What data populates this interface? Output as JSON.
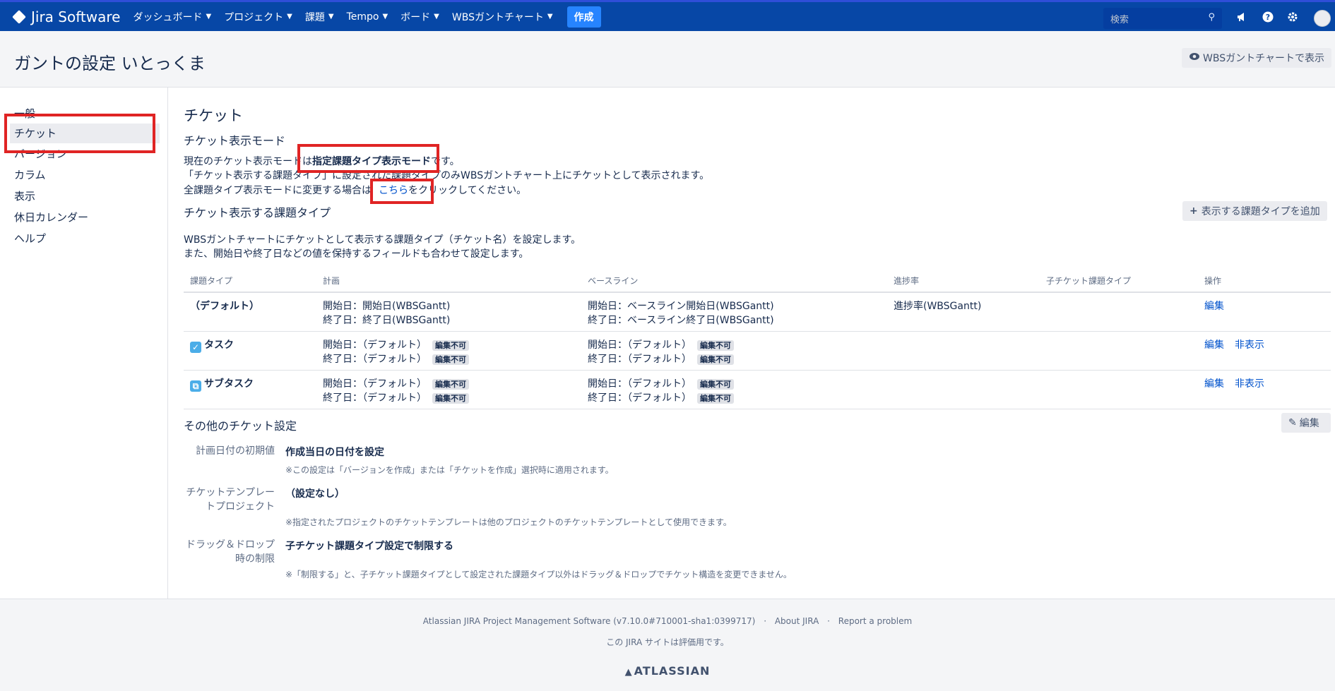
{
  "topnav": {
    "logo": "Jira Software",
    "items": [
      "ダッシュボード",
      "プロジェクト",
      "課題",
      "Tempo",
      "ボード",
      "WBSガントチャート"
    ],
    "create": "作成",
    "search_placeholder": "検索"
  },
  "header": {
    "title": "ガントの設定 いとっくま",
    "view_button": "WBSガントチャートで表示"
  },
  "sidebar": {
    "items": [
      "一般",
      "チケット",
      "バージョン",
      "カラム",
      "表示",
      "休日カレンダー",
      "ヘルプ"
    ]
  },
  "main": {
    "title": "チケット",
    "mode_heading": "チケット表示モード",
    "mode_line1_prefix": "現在のチケット表示モードは",
    "mode_line1_bold": "指定課題タイプ表示モード",
    "mode_line1_suffix": "です。",
    "mode_line2": "「チケット表示する課題タイプ」に設定された課題タイプのみWBSガントチャート上にチケットとして表示されます。",
    "mode_line3_prefix": "全課題タイプ表示モードに変更する場合は",
    "mode_line3_link": "こちら",
    "mode_line3_suffix": "をクリックしてください。",
    "types_heading": "チケット表示する課題タイプ",
    "add_type_button": "表示する課題タイプを追加",
    "types_desc1": "WBSガントチャートにチケットとして表示する課題タイプ（チケット名）を設定します。",
    "types_desc2": "また、開始日や終了日などの値を保持するフィールドも合わせて設定します。",
    "table": {
      "headers": [
        "課題タイプ",
        "計画",
        "ベースライン",
        "進捗率",
        "子チケット課題タイプ",
        "操作"
      ],
      "rows": [
        {
          "type": "（デフォルト）",
          "plan1": "開始日：開始日(WBSGantt)",
          "plan2": "終了日：終了日(WBSGantt)",
          "base1": "開始日：ベースライン開始日(WBSGantt)",
          "base2": "終了日：ベースライン終了日(WBSGantt)",
          "progress": "進捗率(WBSGantt)",
          "edit": "編集"
        },
        {
          "type": "タスク",
          "plan1": "開始日：（デフォルト）",
          "plan2": "終了日：（デフォルト）",
          "base1": "開始日：（デフォルト）",
          "base2": "終了日：（デフォルト）",
          "badge": "編集不可",
          "edit": "編集",
          "hide": "非表示"
        },
        {
          "type": "サブタスク",
          "plan1": "開始日：（デフォルト）",
          "plan2": "終了日：（デフォルト）",
          "base1": "開始日：（デフォルト）",
          "base2": "終了日：（デフォルト）",
          "badge": "編集不可",
          "edit": "編集",
          "hide": "非表示"
        }
      ]
    },
    "other_heading": "その他のチケット設定",
    "edit_button": "編集",
    "settings": [
      {
        "label1": "計画日付の初期値",
        "value": "作成当日の日付を設定",
        "note": "※この設定は「バージョンを作成」または「チケットを作成」選択時に適用されます。"
      },
      {
        "label1": "チケットテンプレー",
        "label2": "トプロジェクト",
        "value": "（設定なし）",
        "note": "※指定されたプロジェクトのチケットテンプレートは他のプロジェクトのチケットテンプレートとして使用できます。"
      },
      {
        "label1": "ドラッグ＆ドロップ",
        "label2": "時の制限",
        "value": "子チケット課題タイプ設定で制限する",
        "note": "※「制限する」と、子チケット課題タイプとして設定された課題タイプ以外はドラッグ＆ドロップでチケット構造を変更できません。"
      }
    ]
  },
  "footer": {
    "software": "Atlassian JIRA Project Management Software (v7.10.0#710001-sha1:0399717)",
    "about": "About JIRA",
    "report": "Report a problem",
    "eval": "この JIRA サイトは評価用です。",
    "brand": "ATLASSIAN"
  },
  "colors": {
    "nav_bg": "#0747a6",
    "link": "#0052cc",
    "highlight_box": "#e02424",
    "create_button": "#2684ff"
  }
}
